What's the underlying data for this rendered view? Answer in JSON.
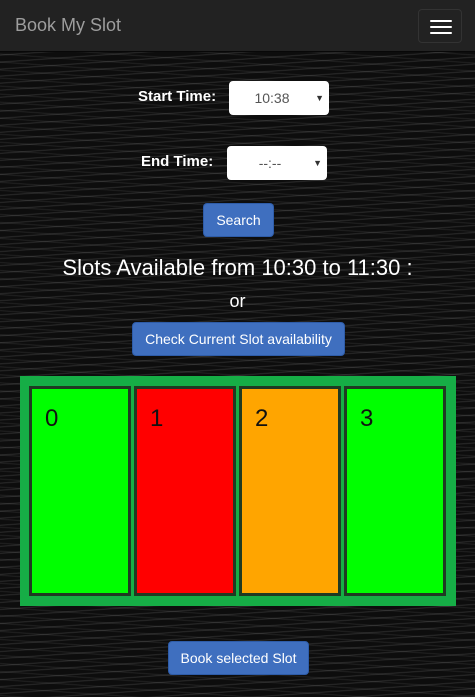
{
  "navbar": {
    "brand": "Book My Slot",
    "menu_icon": "hamburger-menu-icon"
  },
  "form": {
    "start_label": "Start Time:",
    "start_value": "10:38",
    "end_label": "End Time:",
    "end_value": "--:--",
    "search_label": "Search"
  },
  "availability": {
    "heading": "Slots Available from 10:30 to 11:30 :",
    "or_text": "or",
    "check_button": "Check Current Slot availability"
  },
  "slots": [
    {
      "label": "0",
      "color": "#00ff00"
    },
    {
      "label": "1",
      "color": "#ff0000"
    },
    {
      "label": "2",
      "color": "#ffa500"
    },
    {
      "label": "3",
      "color": "#00ff00"
    }
  ],
  "slots_background": "#16ad46",
  "book_button": "Book selected Slot",
  "accent_color": "#3f6fbf"
}
